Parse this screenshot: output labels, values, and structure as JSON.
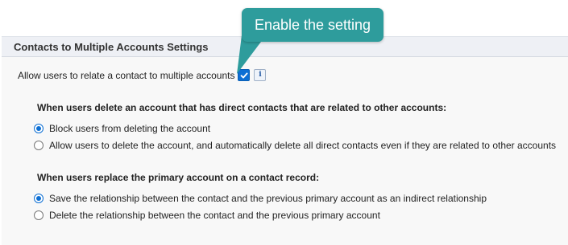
{
  "callout": {
    "text": "Enable the setting",
    "color": "#2e9c9c"
  },
  "section": {
    "title": "Contacts to Multiple Accounts Settings"
  },
  "allow_setting": {
    "label": "Allow users to relate a contact to multiple accounts",
    "checked": true,
    "info_icon_glyph": "i"
  },
  "delete_group": {
    "heading": "When users delete an account that has direct contacts that are related to other accounts:",
    "options": [
      {
        "label": "Block users from deleting the account",
        "selected": true
      },
      {
        "label": "Allow users to delete the account, and automatically delete all direct contacts even if they are related to other accounts",
        "selected": false
      }
    ]
  },
  "replace_group": {
    "heading": "When users replace the primary account on a contact record:",
    "options": [
      {
        "label": "Save the relationship between the contact and the previous primary account as an indirect relationship",
        "selected": true
      },
      {
        "label": "Delete the relationship between the contact and the previous primary account",
        "selected": false
      }
    ]
  },
  "colors": {
    "accent": "#0d6fd4",
    "header_bg": "#eef0f5",
    "panel_bg": "#f8f8f8"
  }
}
